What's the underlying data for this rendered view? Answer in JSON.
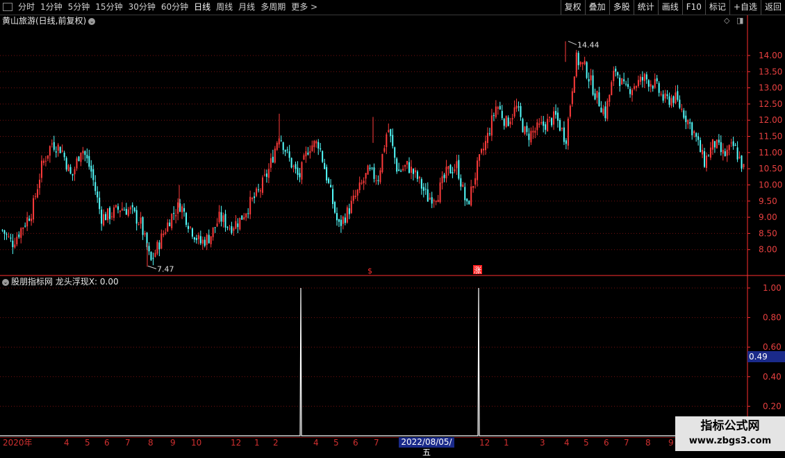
{
  "toolbar": {
    "tabs": [
      "分时",
      "1分钟",
      "5分钟",
      "15分钟",
      "30分钟",
      "60分钟",
      "日线",
      "周线",
      "月线",
      "多周期",
      "更多 >"
    ],
    "active_tab": "日线",
    "right_buttons": [
      "复权",
      "叠加",
      "多股",
      "统计",
      "画线",
      "F10",
      "标记",
      "+自选",
      "返回"
    ]
  },
  "main_panel": {
    "title": "黄山旅游(日线,前复权)",
    "high_marker": "14.44",
    "low_marker": "7.47",
    "signal_marks": [
      "$",
      "涨"
    ],
    "y_ticks": [
      "14.00",
      "13.50",
      "13.00",
      "12.50",
      "12.00",
      "11.50",
      "11.00",
      "10.50",
      "10.00",
      "9.50",
      "9.00",
      "8.50",
      "8.00"
    ]
  },
  "indicator_panel": {
    "title": "股朋指标网 龙头浮现X: 0.00",
    "y_ticks": [
      "1.00",
      "0.80",
      "0.60",
      "0.40",
      "0.20"
    ],
    "cursor_value": "0.49"
  },
  "x_axis": {
    "labels": [
      "2020年",
      "4",
      "5",
      "6",
      "7",
      "8",
      "9",
      "10",
      "12",
      "1",
      "2",
      "4",
      "5",
      "6",
      "7",
      "12",
      "1",
      "3",
      "4",
      "5",
      "6",
      "7",
      "8",
      "9"
    ],
    "cursor_date": "2022/08/05/五"
  },
  "watermark": {
    "line1": "指标公式网",
    "line2": "www.zbgs3.com"
  },
  "colors": {
    "up": "#ff3b3b",
    "down": "#54ffff",
    "grid": "#7a1010",
    "axis": "#ff3030",
    "indicator": "#ffffff"
  },
  "chart_data": [
    {
      "type": "candlestick",
      "title": "黄山旅游(日线,前复权)",
      "ylim": [
        7.2,
        14.9
      ],
      "key_prices": {
        "high": 14.44,
        "low": 7.47
      },
      "close_path": [
        8.6,
        8.2,
        8.7,
        9.2,
        10.6,
        11.3,
        11.1,
        10.2,
        11.2,
        10.4,
        9.0,
        9.1,
        9.3,
        9.2,
        8.8,
        7.6,
        8.3,
        9.0,
        9.4,
        8.7,
        8.2,
        8.4,
        9.0,
        8.7,
        8.9,
        9.4,
        9.8,
        10.5,
        11.6,
        10.8,
        10.2,
        11.2,
        11.3,
        10.0,
        8.7,
        9.2,
        9.8,
        10.4,
        10.2,
        11.8,
        10.4,
        10.6,
        10.2,
        9.6,
        9.7,
        10.4,
        10.6,
        9.3,
        10.5,
        11.4,
        12.5,
        11.9,
        12.4,
        11.5,
        11.7,
        11.9,
        12.1,
        11.4,
        13.9,
        13.6,
        12.8,
        12.2,
        13.6,
        12.9,
        13.1,
        13.3,
        13.1,
        12.6,
        12.7,
        12.2,
        11.6,
        10.7,
        11.3,
        10.9,
        11.2,
        10.5
      ]
    },
    {
      "type": "line",
      "series": [
        {
          "name": "龙头浮现X",
          "spikes": [
            {
              "date_label": "2021-02",
              "value": 1.0
            },
            {
              "date_label": "2022-08",
              "value": 1.0
            }
          ]
        }
      ],
      "ylim": [
        0,
        1.05
      ]
    }
  ]
}
